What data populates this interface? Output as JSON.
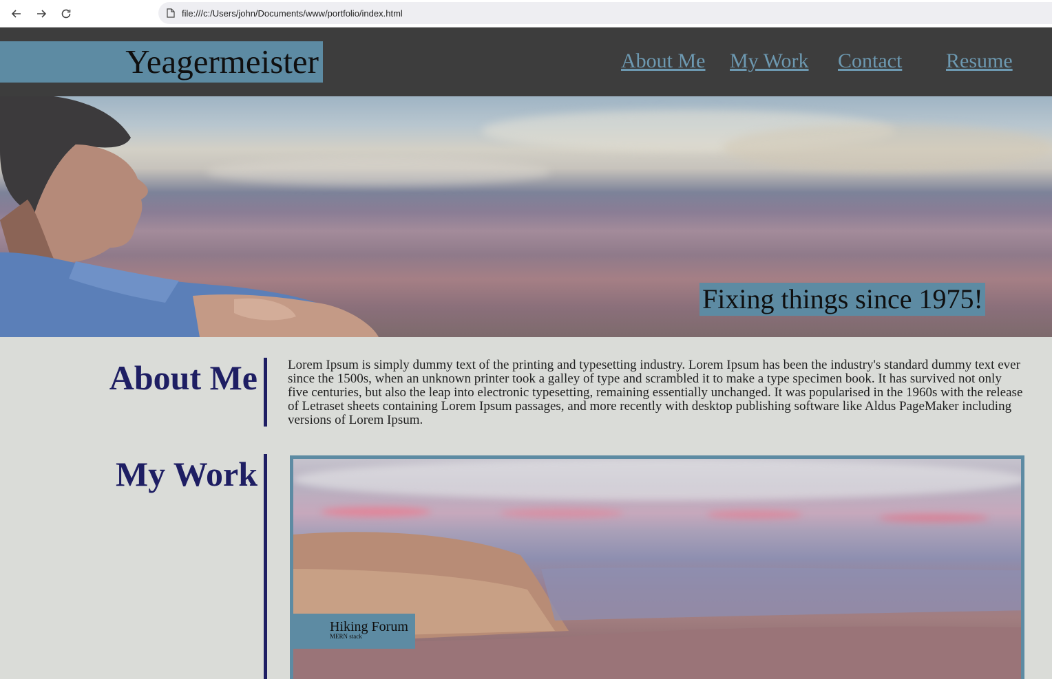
{
  "browser": {
    "url": "file:///c:/Users/john/Documents/www/portfolio/index.html",
    "icons": [
      "back-arrow-icon",
      "forward-arrow-icon",
      "reload-icon",
      "file-icon"
    ]
  },
  "header": {
    "logo": "Yeagermeister",
    "nav": [
      {
        "label": "About Me"
      },
      {
        "label": "My Work"
      },
      {
        "label": "Contact"
      },
      {
        "label": "Resume"
      }
    ]
  },
  "hero": {
    "tagline": "Fixing things since 1975!"
  },
  "about": {
    "title": "About Me",
    "text": "Lorem Ipsum is simply dummy text of the printing and typesetting industry. Lorem Ipsum has been the industry's standard dummy text ever since the 1500s, when an unknown printer took a galley of type and scrambled it to make a type specimen book. It has survived not only five centuries, but also the leap into electronic typesetting, remaining essentially unchanged. It was popularised in the 1960s with the release of Letraset sheets containing Lorem Ipsum passages, and more recently with desktop publishing software like Aldus PageMaker including versions of Lorem Ipsum."
  },
  "work": {
    "title": "My Work",
    "projects": [
      {
        "title": "Hiking Forum",
        "subtitle": "MERN stack"
      }
    ]
  },
  "colors": {
    "header_bg": "#3d3d3d",
    "accent": "#5d8ba3",
    "link": "#6d99b1",
    "heading": "#1e1e63",
    "page_bg": "#dadcd8"
  }
}
